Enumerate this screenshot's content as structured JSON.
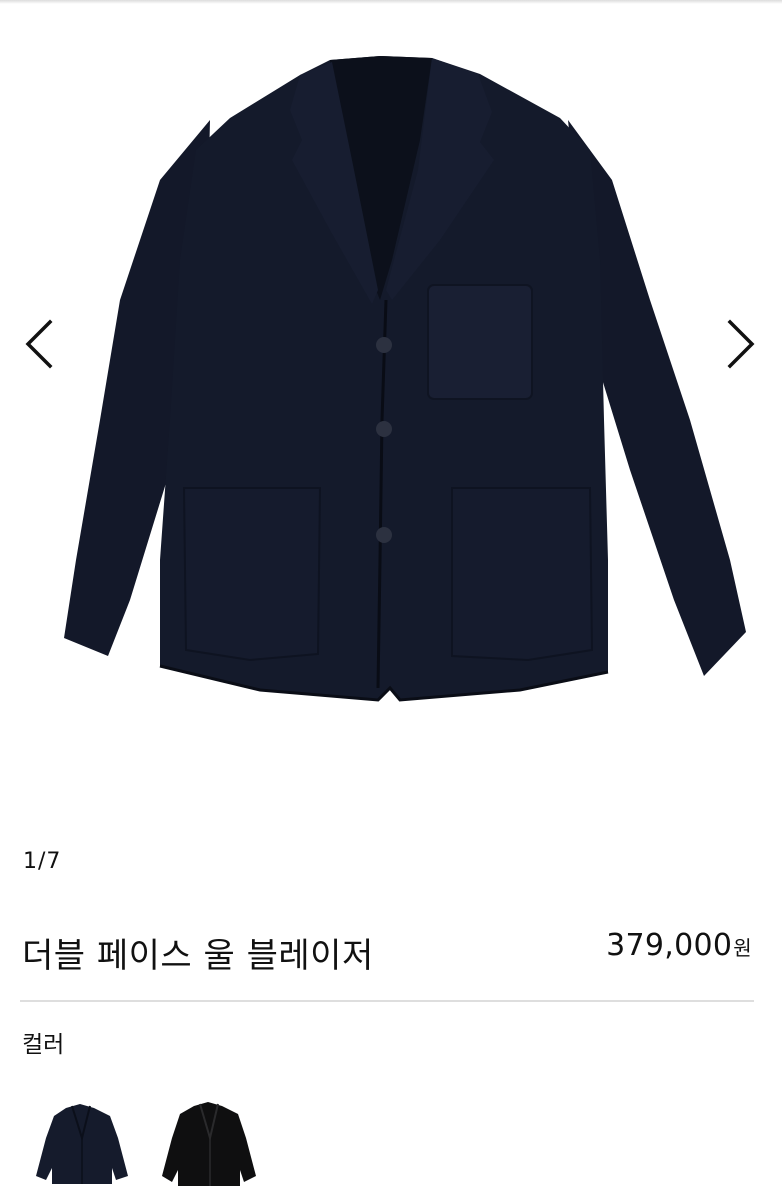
{
  "gallery": {
    "counter": "1/7",
    "prev_icon": "chevron-left-icon",
    "next_icon": "chevron-right-icon",
    "image_alt": "navy jacket"
  },
  "product": {
    "title": "더블 페이스 울 블레이저",
    "price": "379,000",
    "currency": "원"
  },
  "options": {
    "color_label": "컬러",
    "swatches": [
      {
        "name": "navy",
        "color": "#151b2c"
      },
      {
        "name": "black",
        "color": "#0f0f10"
      }
    ]
  },
  "colors": {
    "jacket": "#141a2b",
    "jacket_shadow": "#0b0f1a",
    "text": "#111111",
    "divider": "#dedede"
  }
}
